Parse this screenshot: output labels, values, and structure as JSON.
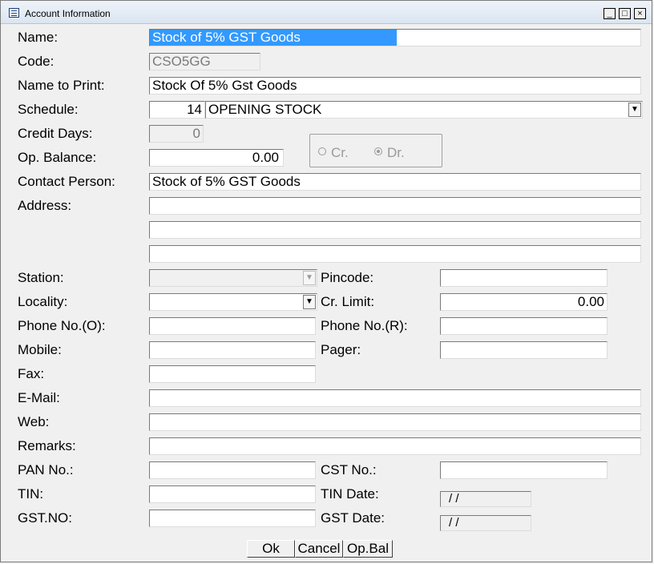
{
  "window": {
    "title": "Account Information",
    "minimize": "_",
    "maximize": "□",
    "close": "×"
  },
  "fields": {
    "name": {
      "label": "Name:",
      "value": "Stock of 5% GST Goods"
    },
    "code": {
      "label": "Code:",
      "value": "CSO5GG"
    },
    "name_to_print": {
      "label": "Name to Print:",
      "value": "Stock Of 5% Gst Goods"
    },
    "schedule": {
      "label": "Schedule:",
      "number": "14",
      "value": "OPENING STOCK"
    },
    "credit_days": {
      "label": "Credit Days:",
      "value": "0"
    },
    "op_balance": {
      "label": "Op. Balance:",
      "value": "0.00",
      "cr": "Cr.",
      "dr": "Dr.",
      "selected": "Dr."
    },
    "contact_person": {
      "label": "Contact Person:",
      "value": "Stock of 5% GST Goods"
    },
    "address": {
      "label": "Address:",
      "lines": [
        "",
        "",
        ""
      ]
    },
    "station": {
      "label": "Station:",
      "value": ""
    },
    "pincode": {
      "label": "Pincode:",
      "value": ""
    },
    "locality": {
      "label": "Locality:",
      "value": ""
    },
    "cr_limit": {
      "label": "Cr. Limit:",
      "value": "0.00"
    },
    "phone_o": {
      "label": "Phone No.(O):",
      "value": ""
    },
    "phone_r": {
      "label": "Phone No.(R):",
      "value": ""
    },
    "mobile": {
      "label": "Mobile:",
      "value": ""
    },
    "pager": {
      "label": "Pager:",
      "value": ""
    },
    "fax": {
      "label": "Fax:",
      "value": ""
    },
    "email": {
      "label": "E-Mail:",
      "value": ""
    },
    "web": {
      "label": "Web:",
      "value": ""
    },
    "remarks": {
      "label": "Remarks:",
      "value": ""
    },
    "pan": {
      "label": "PAN No.:",
      "value": ""
    },
    "cst": {
      "label": "CST No.:",
      "value": ""
    },
    "tin": {
      "label": "TIN:",
      "value": ""
    },
    "tin_date": {
      "label": "TIN Date:",
      "value": "/  /"
    },
    "gst_no": {
      "label": "GST.NO:",
      "value": ""
    },
    "gst_date": {
      "label": "GST Date:",
      "value": "/  /"
    }
  },
  "buttons": {
    "ok": "Ok",
    "cancel": "Cancel",
    "op_bal": "Op.Bal"
  },
  "colors": {
    "selection": "#3399ff",
    "background": "#f0f0f0"
  }
}
